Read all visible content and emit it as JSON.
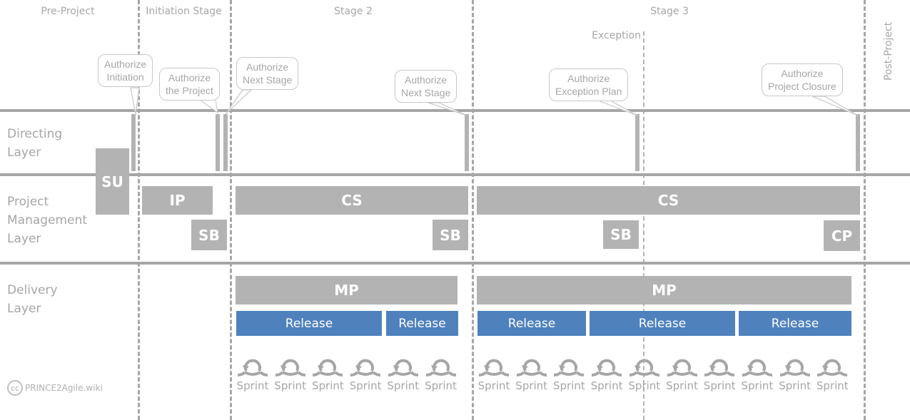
{
  "stages": {
    "pre_project": "Pre-Project",
    "initiation": "Initiation Stage",
    "stage2": "Stage 2",
    "stage3": "Stage 3",
    "post_project": "Post-Project",
    "exception": "Exception"
  },
  "layers": {
    "directing": "Directing Layer",
    "directing_l1": "Directing",
    "directing_l2": "Layer",
    "pm_l1": "Project",
    "pm_l2": "Management",
    "pm_l3": "Layer",
    "delivery_l1": "Delivery",
    "delivery_l2": "Layer"
  },
  "callouts": {
    "auth_initiation_l1": "Authorize",
    "auth_initiation_l2": "Initiation",
    "auth_project_l1": "Authorize",
    "auth_project_l2": "the Project",
    "auth_next1_l1": "Authorize",
    "auth_next1_l2": "Next Stage",
    "auth_next2_l1": "Authorize",
    "auth_next2_l2": "Next Stage",
    "auth_exception_l1": "Authorize",
    "auth_exception_l2": "Exception Plan",
    "auth_closure_l1": "Authorize",
    "auth_closure_l2": "Project Closure"
  },
  "processes": {
    "su": "SU",
    "ip": "IP",
    "sb1": "SB",
    "cs2": "CS",
    "sb2": "SB",
    "cs3": "CS",
    "sb3": "SB",
    "cp": "CP",
    "mp2": "MP",
    "mp3": "MP"
  },
  "releases": {
    "s2": [
      "Release",
      "Release"
    ],
    "s3": [
      "Release",
      "Release",
      "Release"
    ]
  },
  "sprints": {
    "label": "Sprint",
    "stage2_count": 6,
    "stage3_count": 10
  },
  "footer": {
    "cc_icon": "cc",
    "site": "PRINCE2Agile.wiki"
  },
  "colors": {
    "process_gray": "#b3b3b3",
    "release_blue": "#4f81bd",
    "line_gray": "#a6a6a6"
  }
}
